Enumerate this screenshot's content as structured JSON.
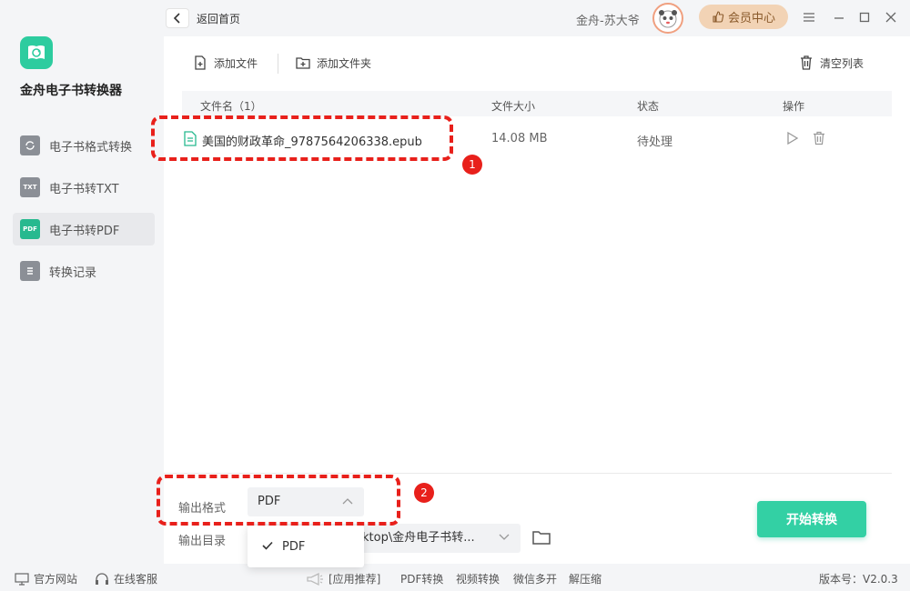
{
  "app": {
    "name": "金舟电子书转换器"
  },
  "sidebar": {
    "items": [
      {
        "label": "电子书格式转换",
        "icon": "convert-icon"
      },
      {
        "label": "电子书转TXT",
        "icon": "txt-icon",
        "icon_text": "TXT"
      },
      {
        "label": "电子书转PDF",
        "icon": "pdf-icon",
        "icon_text": "PDF",
        "active": true
      },
      {
        "label": "转换记录",
        "icon": "record-icon"
      }
    ]
  },
  "topbar": {
    "back_label": "返回首页",
    "username": "金舟-苏大爷",
    "vip_label": "会员中心"
  },
  "toolbar": {
    "add_file": "添加文件",
    "add_folder": "添加文件夹",
    "clear_list": "清空列表"
  },
  "table": {
    "headers": {
      "name": "文件名（1）",
      "size": "文件大小",
      "status": "状态",
      "actions": "操作"
    },
    "rows": [
      {
        "name": "美国的财政革命_9787564206338.epub",
        "size": "14.08 MB",
        "status": "待处理"
      }
    ]
  },
  "output": {
    "format_label": "输出格式",
    "format_value": "PDF",
    "dir_label": "输出目录",
    "dir_value": "ktop\\金舟电子书转...",
    "start_label": "开始转换",
    "dropdown_options": [
      "PDF"
    ]
  },
  "annotations": [
    "1",
    "2"
  ],
  "footer": {
    "website": "官方网站",
    "support": "在线客服",
    "recommend": "[应用推荐]",
    "links": [
      "PDF转换",
      "视频转换",
      "微信多开",
      "解压缩"
    ],
    "version": "版本号：V2.0.3"
  },
  "colors": {
    "accent": "#33d0a4",
    "annotation": "#e8201b",
    "vip": "#f2d3b5"
  }
}
